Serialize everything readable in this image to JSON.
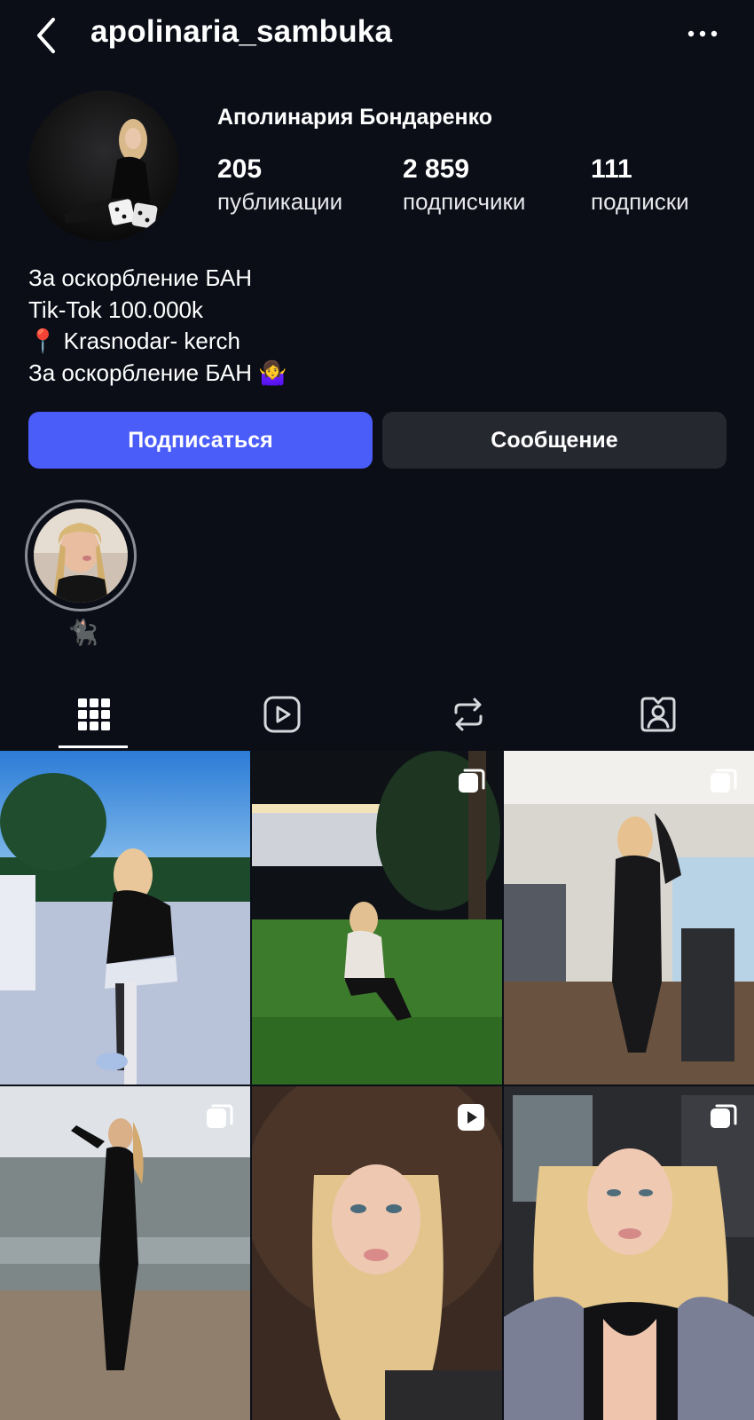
{
  "header": {
    "username": "apolinaria_sambuka",
    "back_icon": "chevron-left-icon",
    "more_icon": "more-horizontal-icon"
  },
  "profile": {
    "full_name": "Аполинария Бондаренко",
    "stats": [
      {
        "value": "205",
        "label": "публикации"
      },
      {
        "value": "2 859",
        "label": "подписчики"
      },
      {
        "value": "111",
        "label": "подписки"
      }
    ],
    "bio": [
      "За оскорбление БАН",
      "Tik-Tok 100.000k",
      "📍 Krasnodar- kerch",
      "За оскорбление БАН 🤷‍♀️"
    ]
  },
  "actions": {
    "follow_label": "Подписаться",
    "message_label": "Сообщение"
  },
  "highlights": [
    {
      "label": "🐈‍⬛"
    }
  ],
  "tabs": [
    {
      "icon": "grid-icon",
      "active": true
    },
    {
      "icon": "reels-icon",
      "active": false
    },
    {
      "icon": "reposts-icon",
      "active": false
    },
    {
      "icon": "tagged-icon",
      "active": false
    }
  ],
  "posts": [
    {
      "badge": "none"
    },
    {
      "badge": "carousel-icon"
    },
    {
      "badge": "carousel-icon"
    },
    {
      "badge": "carousel-icon"
    },
    {
      "badge": "reel-icon"
    },
    {
      "badge": "carousel-icon"
    }
  ],
  "colors": {
    "background": "#0b0e17",
    "follow_button": "#4a5df9",
    "message_button": "#262830"
  }
}
